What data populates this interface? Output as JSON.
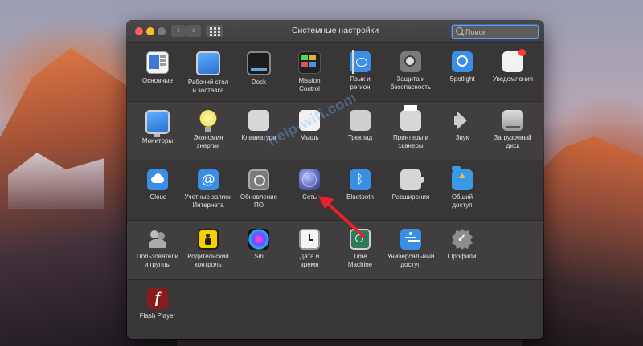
{
  "window": {
    "title": "Системные настройки",
    "search_placeholder": "Поиск"
  },
  "toolbar": {
    "back_glyph": "‹",
    "forward_glyph": "›"
  },
  "rows": [
    [
      {
        "label": "Основные",
        "icon": "general-icon"
      },
      {
        "label": "Рабочий стол\nи заставка",
        "icon": "desktop-screensaver-icon"
      },
      {
        "label": "Dock",
        "icon": "dock-icon"
      },
      {
        "label": "Mission\nControl",
        "icon": "mission-control-icon"
      },
      {
        "label": "Язык и\nрегион",
        "icon": "language-region-icon"
      },
      {
        "label": "Защита и\nбезопасность",
        "icon": "security-icon"
      },
      {
        "label": "Spotlight",
        "icon": "spotlight-icon"
      },
      {
        "label": "Уведомления",
        "icon": "notifications-icon"
      }
    ],
    [
      {
        "label": "Мониторы",
        "icon": "displays-icon"
      },
      {
        "label": "Экономия\nэнергии",
        "icon": "energy-saver-icon"
      },
      {
        "label": "Клавиатура",
        "icon": "keyboard-icon"
      },
      {
        "label": "Мышь",
        "icon": "mouse-icon"
      },
      {
        "label": "Трекпад",
        "icon": "trackpad-icon"
      },
      {
        "label": "Принтеры и\nсканеры",
        "icon": "printers-icon"
      },
      {
        "label": "Звук",
        "icon": "sound-icon"
      },
      {
        "label": "Загрузочный\nдиск",
        "icon": "startup-disk-icon"
      }
    ],
    [
      {
        "label": "iCloud",
        "icon": "icloud-icon"
      },
      {
        "label": "Учетные записи\nИнтернета",
        "icon": "internet-accounts-icon",
        "glyph": "@"
      },
      {
        "label": "Обновление\nПО",
        "icon": "software-update-icon"
      },
      {
        "label": "Сеть",
        "icon": "network-icon"
      },
      {
        "label": "Bluetooth",
        "icon": "bluetooth-icon",
        "glyph": "ᛒ"
      },
      {
        "label": "Расширения",
        "icon": "extensions-icon"
      },
      {
        "label": "Общий\nдоступ",
        "icon": "sharing-icon"
      }
    ],
    [
      {
        "label": "Пользователи\nи группы",
        "icon": "users-groups-icon"
      },
      {
        "label": "Родительский\nконтроль",
        "icon": "parental-controls-icon"
      },
      {
        "label": "Siri",
        "icon": "siri-icon"
      },
      {
        "label": "Дата и\nвремя",
        "icon": "date-time-icon"
      },
      {
        "label": "Time\nMachine",
        "icon": "time-machine-icon"
      },
      {
        "label": "Универсальный\nдоступ",
        "icon": "accessibility-icon"
      },
      {
        "label": "Профили",
        "icon": "profiles-icon"
      }
    ],
    [
      {
        "label": "Flash Player",
        "icon": "flash-player-icon",
        "glyph": "f"
      }
    ]
  ],
  "watermark": "help-wifi.com",
  "colors": {
    "window_bg": "#383637",
    "alt_row_bg": "#403e3f",
    "arrow": "#e8202a",
    "search_focus": "#4aa3ff"
  }
}
